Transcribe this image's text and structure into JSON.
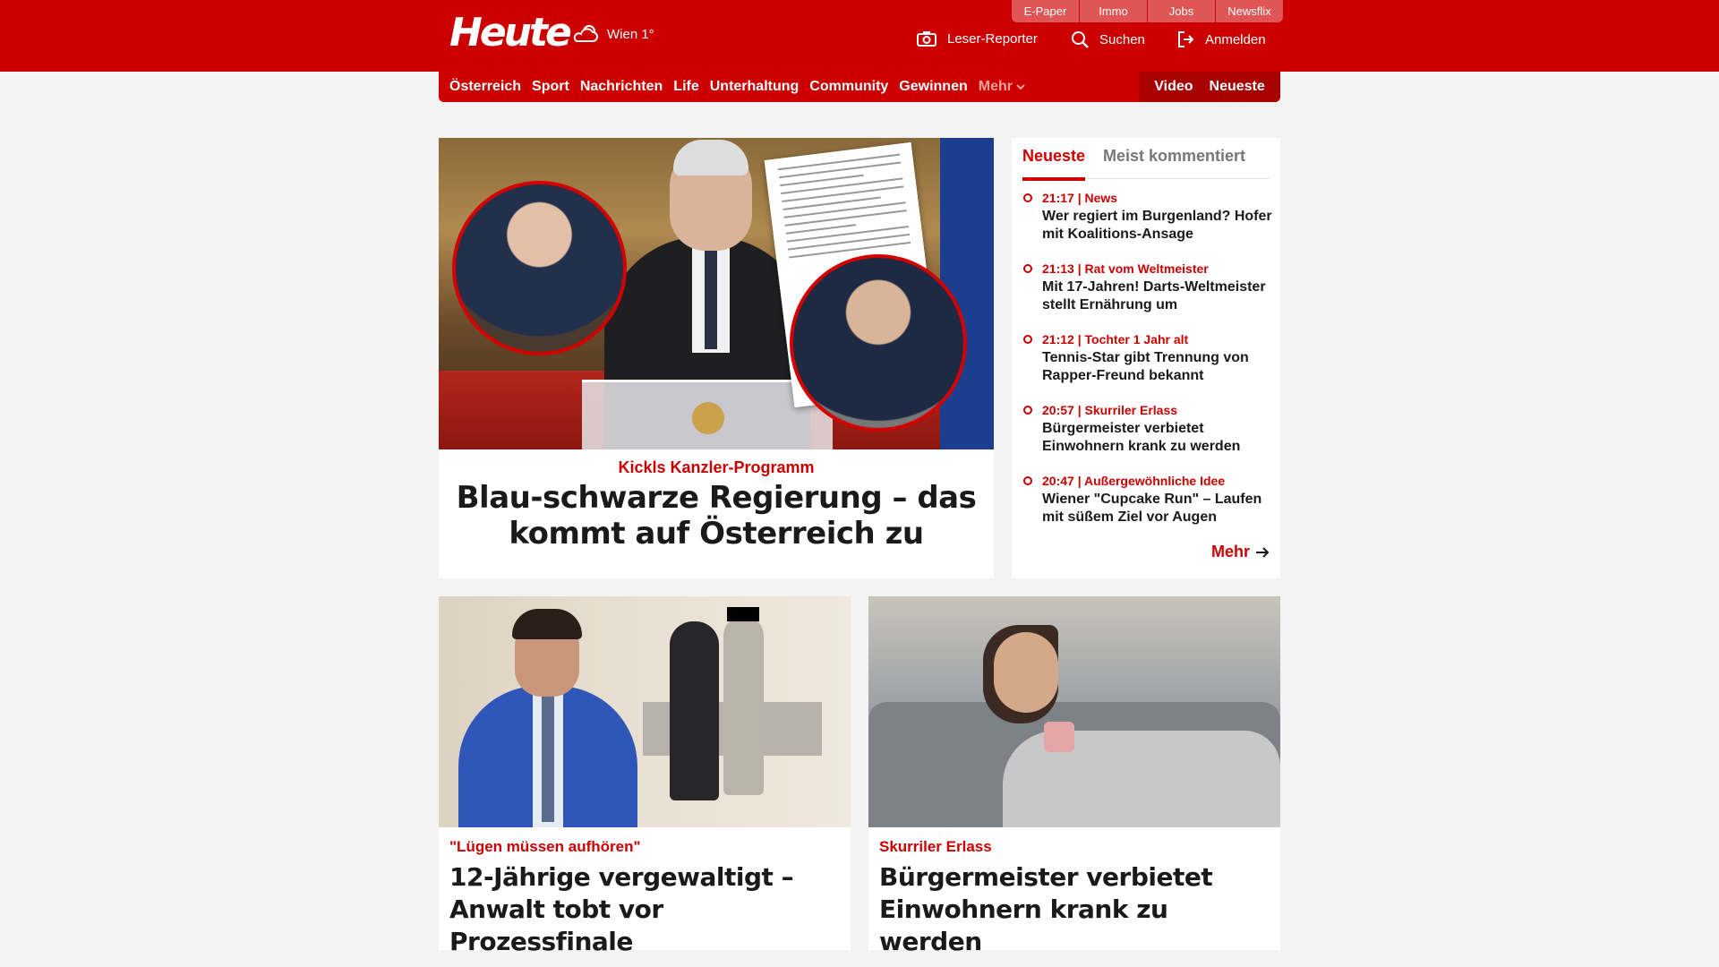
{
  "header": {
    "logo": "Heute",
    "weather": "Wien 1°",
    "top_links": [
      "E-Paper",
      "Immo",
      "Jobs",
      "Newsflix"
    ],
    "actions": {
      "reporter": "Leser-Reporter",
      "search": "Suchen",
      "login": "Anmelden"
    }
  },
  "nav": {
    "items": [
      "Österreich",
      "Sport",
      "Nachrichten",
      "Life",
      "Unterhaltung",
      "Community",
      "Gewinnen"
    ],
    "more": "Mehr",
    "right": [
      "Video",
      "Neueste"
    ]
  },
  "hero": {
    "kicker": "Kickls Kanzler-Programm",
    "title": "Blau-schwarze Regierung – das kommt auf Österreich zu"
  },
  "sidebar": {
    "tabs": [
      "Neueste",
      "Meist kommentiert"
    ],
    "items": [
      {
        "meta": "21:17 | News",
        "title": "Wer regiert im Burgenland? Hofer mit Koalitions-Ansage"
      },
      {
        "meta": "21:13 | Rat vom Weltmeister",
        "title": "Mit 17-Jahren! Darts-Weltmeister stellt Ernährung um"
      },
      {
        "meta": "21:12 | Tochter 1 Jahr alt",
        "title": "Tennis-Star gibt Trennung von Rapper-Freund bekannt"
      },
      {
        "meta": "20:57 | Skurriler Erlass",
        "title": "Bürgermeister verbietet Einwohnern krank zu werden"
      },
      {
        "meta": "20:47 | Außergewöhnliche Idee",
        "title": "Wiener \"Cupcake Run\" – Laufen mit süßem Ziel vor Augen"
      }
    ],
    "more": "Mehr"
  },
  "cards": [
    {
      "kicker": "\"Lügen müssen aufhören\"",
      "title": "12-Jährige vergewaltigt – Anwalt tobt vor Prozessfinale"
    },
    {
      "kicker": "Skurriler Erlass",
      "title": "Bürgermeister verbietet Einwohnern krank zu werden"
    }
  ],
  "colors": {
    "brand": "#cc0000",
    "brand_dark": "#a80000",
    "background": "#f3f3f3"
  }
}
